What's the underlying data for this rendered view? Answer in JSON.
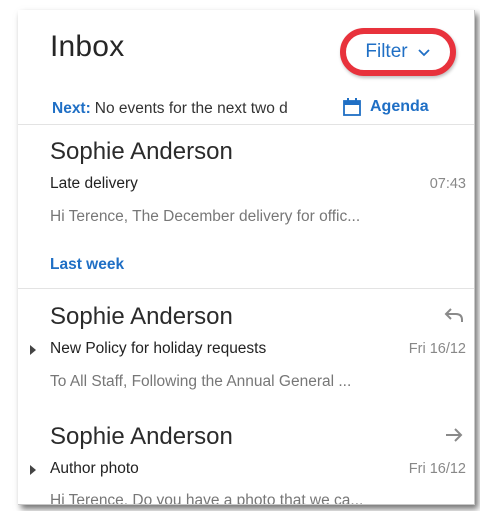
{
  "header": {
    "title": "Inbox",
    "filter_label": "Filter"
  },
  "next": {
    "label": "Next:",
    "text": "No events for the next two d",
    "agenda_label": "Agenda"
  },
  "messages_today": [
    {
      "sender": "Sophie Anderson",
      "subject": "Late delivery",
      "time": "07:43",
      "preview": "Hi Terence,   The December delivery for offic..."
    }
  ],
  "section": {
    "last_week_label": "Last week"
  },
  "messages_last_week": [
    {
      "sender": "Sophie Anderson",
      "subject": "New Policy for holiday requests",
      "time": "Fri 16/12",
      "preview": "To All Staff,   Following the Annual General ...",
      "status_icon": "reply-icon"
    },
    {
      "sender": "Sophie Anderson",
      "subject": "Author photo",
      "time": "Fri 16/12",
      "preview": "Hi Terence,   Do you have a photo that we ca...",
      "status_icon": "forward-icon"
    }
  ],
  "colors": {
    "accent": "#1f6fc5",
    "highlight": "#e8323c"
  }
}
